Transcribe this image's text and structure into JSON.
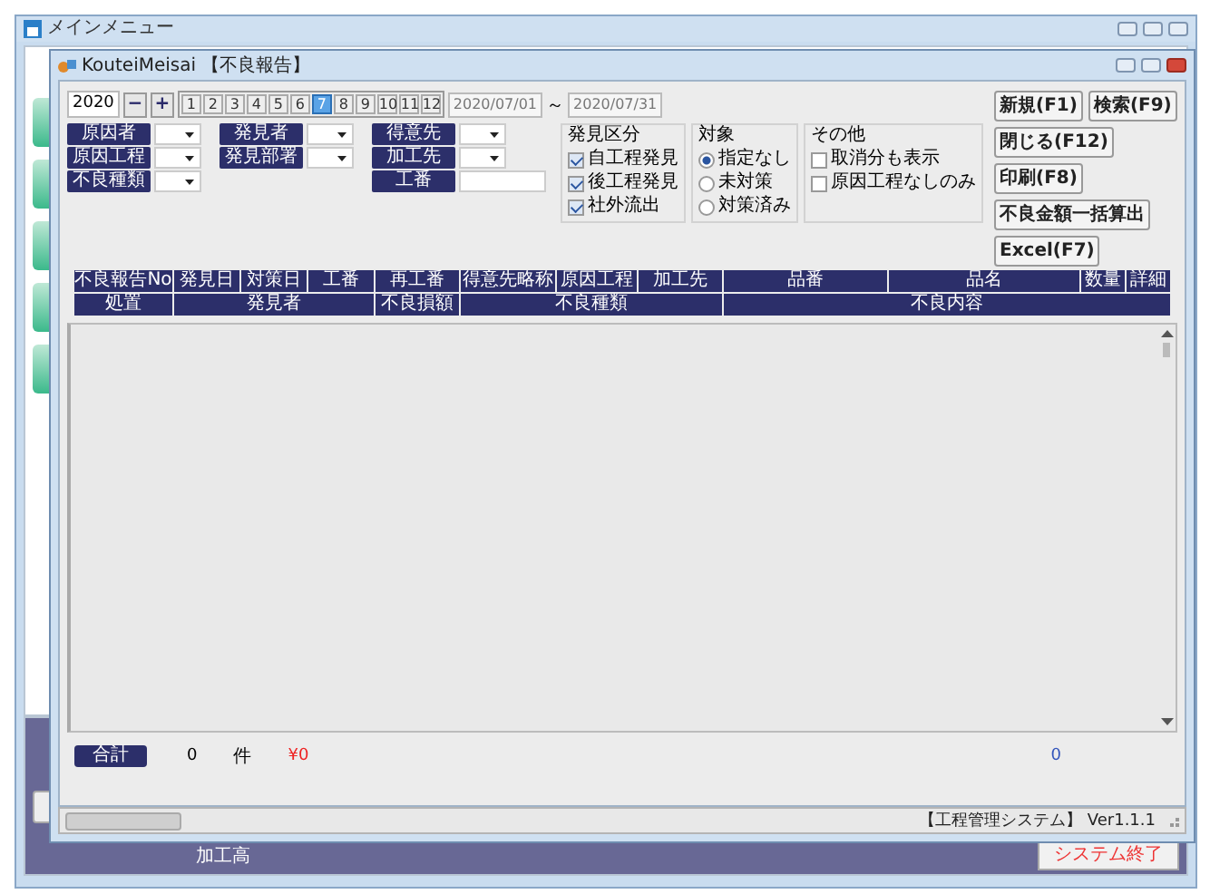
{
  "main_window": {
    "title": "メインメニュー",
    "bottom_label": "加工高",
    "exit_button": "システム終了"
  },
  "dialog": {
    "title": "KouteiMeisai 【不良報告】",
    "year": "2020",
    "year_buttons": [
      "−",
      "+"
    ],
    "months": [
      {
        "label": "1",
        "selected": false
      },
      {
        "label": "2",
        "selected": false
      },
      {
        "label": "3",
        "selected": false
      },
      {
        "label": "4",
        "selected": false
      },
      {
        "label": "5",
        "selected": false
      },
      {
        "label": "6",
        "selected": false
      },
      {
        "label": "7",
        "selected": true
      },
      {
        "label": "8",
        "selected": false
      },
      {
        "label": "9",
        "selected": false
      },
      {
        "label": "10",
        "selected": false
      },
      {
        "label": "11",
        "selected": false
      },
      {
        "label": "12",
        "selected": false
      }
    ],
    "date_from": "2020/07/01",
    "date_separator": "～",
    "date_to": "2020/07/31",
    "filter_columns": [
      [
        {
          "label": "原因者",
          "kind": "dropdown"
        },
        {
          "label": "原因工程",
          "kind": "dropdown"
        },
        {
          "label": "不良種類",
          "kind": "dropdown"
        }
      ],
      [
        {
          "label": "発見者",
          "kind": "dropdown"
        },
        {
          "label": "発見部署",
          "kind": "dropdown"
        }
      ],
      [
        {
          "label": "得意先",
          "kind": "dropdown"
        },
        {
          "label": "加工先",
          "kind": "dropdown"
        },
        {
          "label": "工番",
          "kind": "text"
        }
      ]
    ],
    "groups": [
      {
        "title": "発見区分",
        "kind": "checkbox",
        "options": [
          {
            "label": "自工程発見",
            "checked": true
          },
          {
            "label": "後工程発見",
            "checked": true
          },
          {
            "label": "社外流出",
            "checked": true
          }
        ]
      },
      {
        "title": "対象",
        "kind": "radio",
        "options": [
          {
            "label": "指定なし",
            "selected": true
          },
          {
            "label": "未対策",
            "selected": false
          },
          {
            "label": "対策済み",
            "selected": false
          }
        ]
      },
      {
        "title": "その他",
        "kind": "checkbox",
        "options": [
          {
            "label": "取消分も表示",
            "checked": false
          },
          {
            "label": "原因工程なしのみ",
            "checked": false
          }
        ]
      }
    ],
    "buttons": [
      "新規(F1)",
      "検索(F9)",
      "閉じる(F12)",
      "印刷(F8)",
      "不良金額一括算出",
      "Excel(F7)"
    ],
    "table": {
      "header_row_1": [
        "不良報告No",
        "発見日",
        "対策日",
        "工番",
        "再工番",
        "得意先略称",
        "原因工程",
        "加工先",
        "品番",
        "品名",
        "数量",
        "詳細"
      ],
      "header_row_2": [
        "処置",
        "発見者",
        "不良損額",
        "不良種類",
        "不良内容"
      ]
    },
    "totals": {
      "label": "合計",
      "count": "0",
      "unit": "件",
      "amount": "¥0",
      "right_total": "0"
    },
    "status_text": "【工程管理システム】 Ver1.1.1"
  }
}
